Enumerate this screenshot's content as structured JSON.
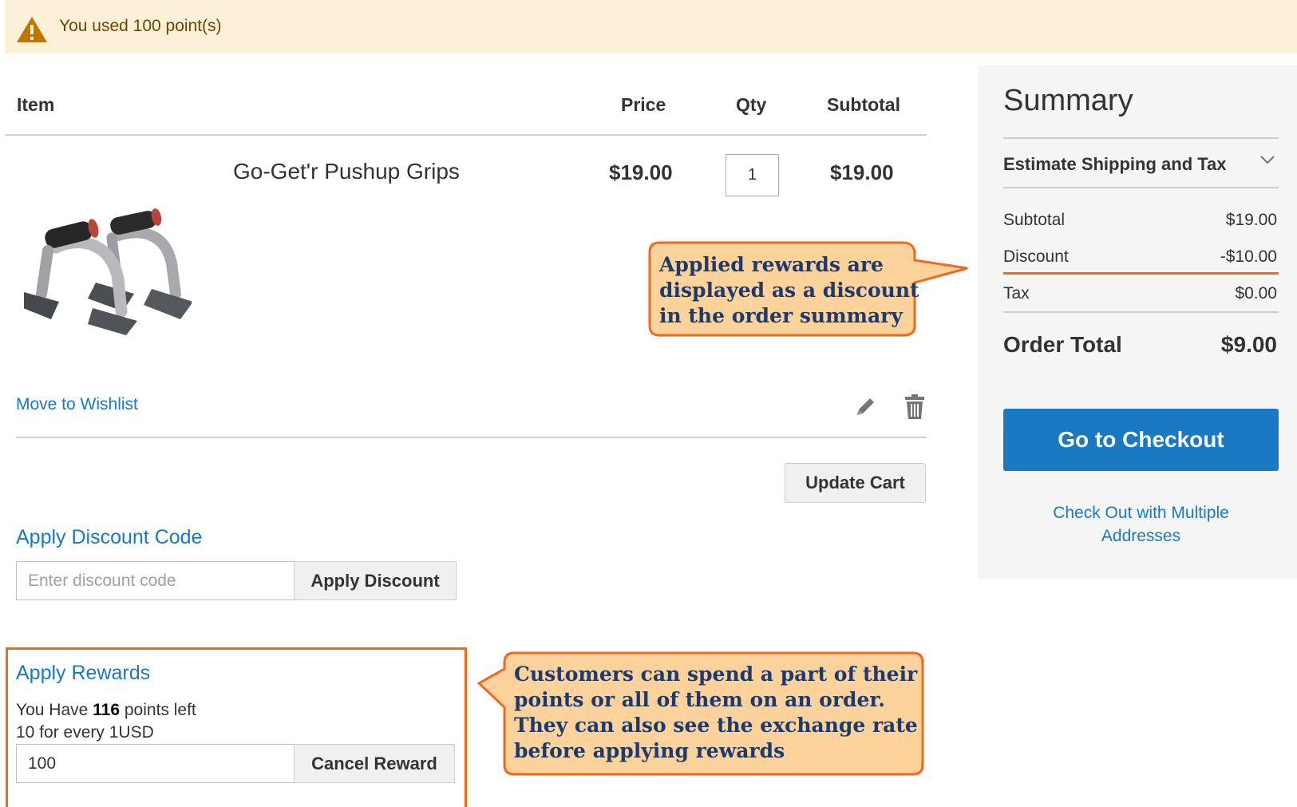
{
  "notice": {
    "text": "You used 100 point(s)",
    "icon": "warning-icon"
  },
  "table": {
    "headers": {
      "item": "Item",
      "price": "Price",
      "qty": "Qty",
      "subtotal": "Subtotal"
    },
    "row": {
      "name": "Go-Get'r Pushup Grips",
      "price": "$19.00",
      "qty": "1",
      "subtotal": "$19.00"
    },
    "wishlist_label": "Move to Wishlist",
    "update_cart_label": "Update Cart"
  },
  "discount": {
    "title": "Apply Discount Code",
    "placeholder": "Enter discount code",
    "button": "Apply Discount"
  },
  "rewards": {
    "title": "Apply Rewards",
    "have_prefix": "You Have",
    "points": "116",
    "have_suffix": "points left",
    "rate": "10 for every 1USD",
    "input_value": "100",
    "button": "Cancel Reward"
  },
  "summary": {
    "title": "Summary",
    "estimate_label": "Estimate Shipping and Tax",
    "rows": [
      {
        "label": "Subtotal",
        "value": "$19.00"
      },
      {
        "label": "Discount",
        "value": "-$10.00"
      },
      {
        "label": "Tax",
        "value": "$0.00"
      }
    ],
    "order_total_label": "Order Total",
    "order_total_value": "$9.00",
    "checkout_label": "Go to Checkout",
    "multi_line1": "Check Out with Multiple",
    "multi_line2": "Addresses"
  },
  "callouts": {
    "summary": [
      "Applied rewards are",
      "displayed as a discount",
      "in the order summary"
    ],
    "rewards": [
      "Customers can spend a part of their",
      "points or all of them on an order.",
      "They can also see the exchange rate",
      "before applying rewards"
    ]
  },
  "colors": {
    "accent": "#1979c3",
    "highlight": "#ef6a1f",
    "callout_fill": "#fdd39b",
    "notice_bg": "#fcf0d9"
  }
}
